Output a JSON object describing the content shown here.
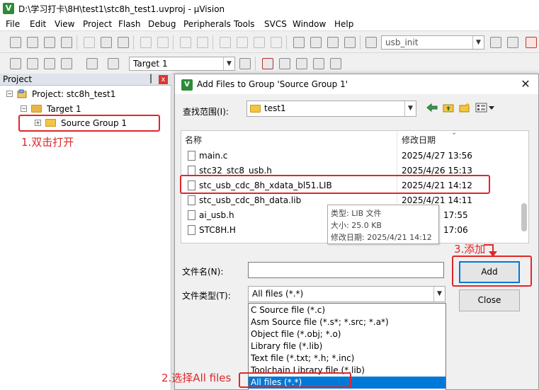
{
  "window": {
    "title": "D:\\学习打卡\\8H\\test1\\stc8h_test1.uvproj - µVision",
    "app_icon": "V"
  },
  "menu": [
    "File",
    "Edit",
    "View",
    "Project",
    "Flash",
    "Debug",
    "Peripherals",
    "Tools",
    "SVCS",
    "Window",
    "Help"
  ],
  "toolbar": {
    "find_value": "usb_init",
    "target_value": "Target 1"
  },
  "project_panel": {
    "title": "Project",
    "pin": "▕",
    "close": "x",
    "project": "Project: stc8h_test1",
    "target": "Target 1",
    "group": "Source Group 1"
  },
  "annotations": {
    "step1": "1.双击打开",
    "step2": "2.选择All files",
    "step3": "3.添加"
  },
  "dialog": {
    "title": "Add Files to Group 'Source Group 1'",
    "icon": "V",
    "close": "✕",
    "look_in_label": "查找范围(I):",
    "look_in_value": "test1",
    "columns": {
      "name": "名称",
      "date": "修改日期"
    },
    "files": [
      {
        "name": "main.c",
        "date": "2025/4/27 13:56"
      },
      {
        "name": "stc32_stc8_usb.h",
        "date": "2025/4/26 15:13"
      },
      {
        "name": "stc_usb_cdc_8h_xdata_bl51.LIB",
        "date": "2025/4/21 14:12"
      },
      {
        "name": "stc_usb_cdc_8h_data.lib",
        "date": "2025/4/21 14:11"
      },
      {
        "name": "ai_usb.h",
        "date": "17:55"
      },
      {
        "name": "STC8H.H",
        "date": "17:06"
      }
    ],
    "tooltip": {
      "type": "类型: LIB 文件",
      "size": "大小: 25.0 KB",
      "date": "修改日期: 2025/4/21 14:12"
    },
    "filename_label": "文件名(N):",
    "filename_value": "",
    "filetype_label": "文件类型(T):",
    "filetype_value": "All files (*.*)",
    "filetype_options": [
      "C Source file (*.c)",
      "Asm Source file (*.s*; *.src; *.a*)",
      "Object file (*.obj; *.o)",
      "Library file (*.lib)",
      "Text file (*.txt; *.h; *.inc)",
      "Toolchain Library file (*.lib)",
      "All files (*.*)"
    ],
    "add_label": "Add",
    "close_label": "Close"
  },
  "colors": {
    "annotation_red": "#e0262a",
    "selection_blue": "#0078d7",
    "folder_yellow": "#f3c642"
  }
}
